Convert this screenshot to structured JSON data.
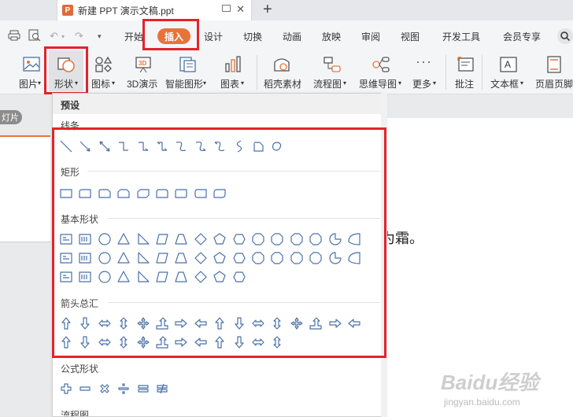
{
  "titlebar": {
    "doc_tab_icon": "P",
    "doc_title": "新建 PPT 演示文稿.ppt",
    "new_tab": "+"
  },
  "menubar": {
    "tabs": [
      "开始",
      "插入",
      "设计",
      "切换",
      "动画",
      "放映",
      "审阅",
      "视图",
      "开发工具",
      "会员专享"
    ],
    "active_tab": "插入"
  },
  "ribbon": {
    "items": [
      {
        "label": "图片",
        "icon": "picture-icon",
        "has_dropdown": true
      },
      {
        "label": "形状",
        "icon": "shapes-icon",
        "has_dropdown": true
      },
      {
        "label": "图标",
        "icon": "icons-icon",
        "has_dropdown": true
      },
      {
        "label": "3D演示",
        "icon": "3d-presentation-icon",
        "has_dropdown": false
      },
      {
        "label": "智能图形",
        "icon": "smartart-icon",
        "has_dropdown": true
      },
      {
        "label": "图表",
        "icon": "chart-icon",
        "has_dropdown": true
      },
      {
        "label": "稻壳素材",
        "icon": "docer-material-icon",
        "has_dropdown": false
      },
      {
        "label": "流程图",
        "icon": "flowchart-icon",
        "has_dropdown": true
      },
      {
        "label": "思维导图",
        "icon": "mindmap-icon",
        "has_dropdown": true
      },
      {
        "label": "更多",
        "icon": "more-icon",
        "has_dropdown": true
      },
      {
        "label": "批注",
        "icon": "comment-icon",
        "has_dropdown": false
      },
      {
        "label": "文本框",
        "icon": "textbox-icon",
        "has_dropdown": true
      },
      {
        "label": "页眉页脚",
        "icon": "header-footer-icon",
        "has_dropdown": false
      }
    ]
  },
  "workspace": {
    "thumb_tag": "灯片",
    "slide_text": "为霜。"
  },
  "shapes_panel": {
    "header": "预设",
    "categories": [
      {
        "name": "线条",
        "count": 12
      },
      {
        "name": "矩形",
        "count": 9
      },
      {
        "name": "基本形状",
        "count": 42
      },
      {
        "name": "箭头总汇",
        "count": 28
      },
      {
        "name": "公式形状",
        "count": 6
      },
      {
        "name": "流程图",
        "count": 0
      }
    ]
  },
  "watermark": {
    "main": "Baidu经验",
    "sub": "jingyan.baidu.com"
  },
  "colors": {
    "accent_orange": "#e8733a",
    "highlight_red": "#e3232c",
    "shape_stroke": "#4a72a8"
  }
}
